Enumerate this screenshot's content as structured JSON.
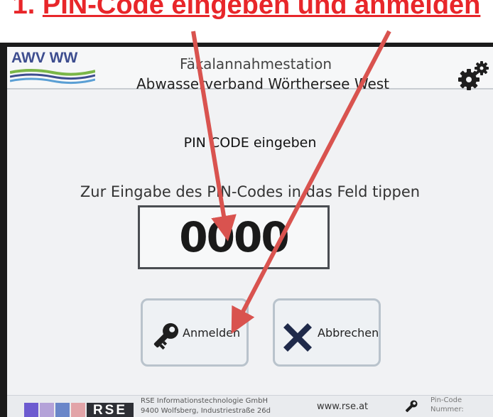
{
  "caption": {
    "number": "1.",
    "text": "PIN-Code eingeben und anmelden"
  },
  "header": {
    "logo_text": "AWV WW",
    "title_line1": "Fäkalannahmestation",
    "title_line2": "Abwasserverband Wörthersee West",
    "settings_icon": "gear-icon"
  },
  "main": {
    "heading": "PIN CODE eingeben",
    "hint": "Zur Eingabe des PIN-Codes in das Feld tippen",
    "pin_value": "0000",
    "buttons": {
      "login": {
        "label": "Anmelden",
        "icon": "key-icon"
      },
      "cancel": {
        "label": "Abbrechen",
        "icon": "x-icon"
      }
    }
  },
  "footer": {
    "brand": "RSE",
    "company_line1": "RSE Informationstechnologie GmbH",
    "company_line2": "9400 Wolfsberg, Industriestraße 26d",
    "website": "www.rse.at",
    "pin_label_line1": "Pin-Code",
    "pin_label_line2": "Nummer:"
  },
  "colors": {
    "annotation_red": "#e8262a",
    "logo_blue": "#3d4d8f",
    "logo_green": "#7ab648",
    "swatch_purple": "#6d5bd0",
    "swatch_lilac": "#b4a2d8",
    "swatch_blue": "#6a86c9",
    "swatch_pink": "#e2a4a8"
  }
}
